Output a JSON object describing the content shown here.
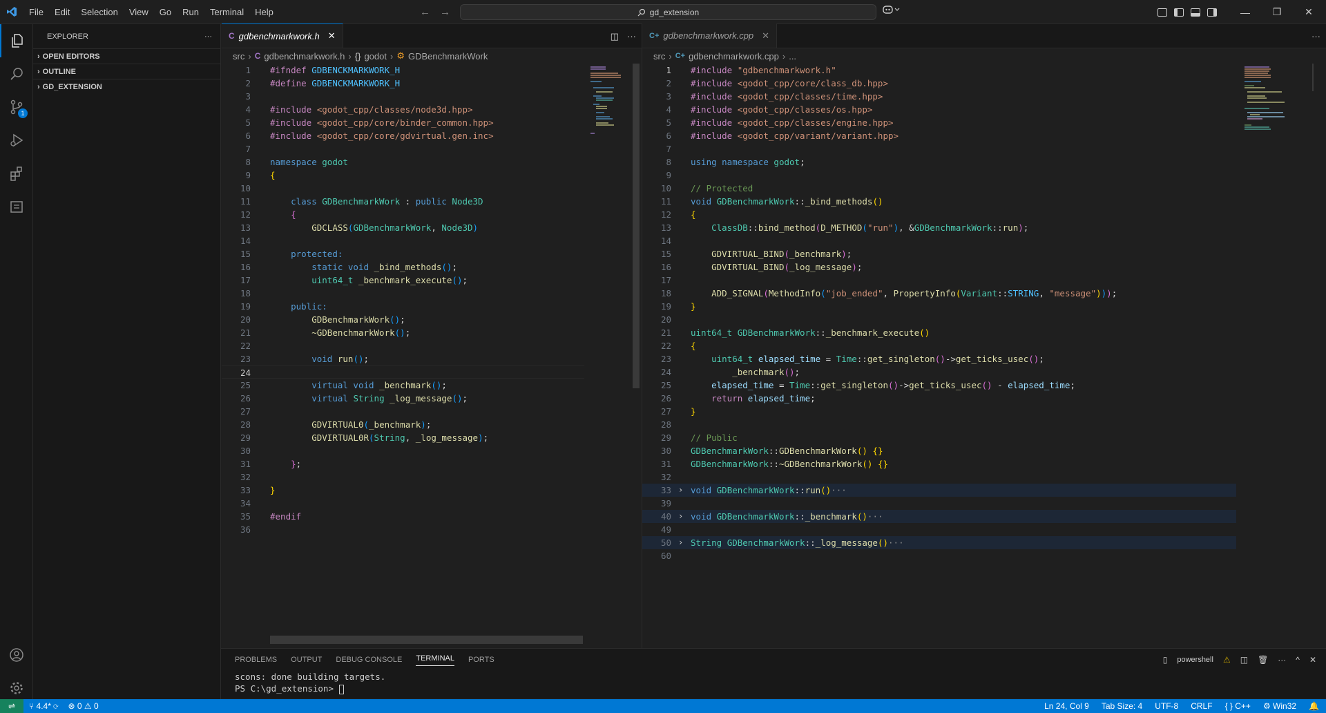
{
  "menu": [
    "File",
    "Edit",
    "Selection",
    "View",
    "Go",
    "Run",
    "Terminal",
    "Help"
  ],
  "search": {
    "text": "gd_extension"
  },
  "window": {
    "minimize": "—",
    "restore": "❐",
    "close": "✕"
  },
  "activity": {
    "scm_badge": "1"
  },
  "sidebar": {
    "title": "EXPLORER",
    "more": "···",
    "sections": [
      "OPEN EDITORS",
      "OUTLINE",
      "GD_EXTENSION"
    ]
  },
  "left_editor": {
    "tab_label": "gdbenchmarkwork.h",
    "breadcrumbs": {
      "folder": "src",
      "file": "gdbenchmarkwork.h",
      "ns": "godot",
      "cls": "GDBenchmarkWork"
    },
    "current_line": 24,
    "lines": [
      [
        [
          "pp",
          "#ifndef "
        ],
        [
          "df",
          "GDBENCKMARKWORK_H"
        ]
      ],
      [
        [
          "pp",
          "#define "
        ],
        [
          "df",
          "GDBENCKMARKWORK_H"
        ]
      ],
      [],
      [
        [
          "pp",
          "#include "
        ],
        [
          "str",
          "<godot_cpp/classes/node3d.hpp>"
        ]
      ],
      [
        [
          "pp",
          "#include "
        ],
        [
          "str",
          "<godot_cpp/core/binder_common.hpp>"
        ]
      ],
      [
        [
          "pp",
          "#include "
        ],
        [
          "str",
          "<godot_cpp/core/gdvirtual.gen.inc>"
        ]
      ],
      [],
      [
        [
          "kw",
          "namespace "
        ],
        [
          "ty",
          "godot"
        ]
      ],
      [
        [
          "br1",
          "{"
        ]
      ],
      [],
      [
        [
          "plain",
          "    "
        ],
        [
          "kw",
          "class "
        ],
        [
          "ty",
          "GDBenchmarkWork"
        ],
        [
          "plain",
          " : "
        ],
        [
          "kw",
          "public "
        ],
        [
          "ty",
          "Node3D"
        ]
      ],
      [
        [
          "plain",
          "    "
        ],
        [
          "br2",
          "{"
        ]
      ],
      [
        [
          "plain",
          "        "
        ],
        [
          "fn",
          "GDCLASS"
        ],
        [
          "br3",
          "("
        ],
        [
          "ty",
          "GDBenchmarkWork"
        ],
        [
          "plain",
          ", "
        ],
        [
          "ty",
          "Node3D"
        ],
        [
          "br3",
          ")"
        ]
      ],
      [],
      [
        [
          "plain",
          "    "
        ],
        [
          "kw",
          "protected:"
        ]
      ],
      [
        [
          "plain",
          "        "
        ],
        [
          "kw",
          "static void "
        ],
        [
          "fn",
          "_bind_methods"
        ],
        [
          "br3",
          "()"
        ],
        [
          "plain",
          ";"
        ]
      ],
      [
        [
          "plain",
          "        "
        ],
        [
          "ty",
          "uint64_t "
        ],
        [
          "fn",
          "_benchmark_execute"
        ],
        [
          "br3",
          "()"
        ],
        [
          "plain",
          ";"
        ]
      ],
      [],
      [
        [
          "plain",
          "    "
        ],
        [
          "kw",
          "public:"
        ]
      ],
      [
        [
          "plain",
          "        "
        ],
        [
          "fn",
          "GDBenchmarkWork"
        ],
        [
          "br3",
          "()"
        ],
        [
          "plain",
          ";"
        ]
      ],
      [
        [
          "plain",
          "        "
        ],
        [
          "fn",
          "~GDBenchmarkWork"
        ],
        [
          "br3",
          "()"
        ],
        [
          "plain",
          ";"
        ]
      ],
      [],
      [
        [
          "plain",
          "        "
        ],
        [
          "kw",
          "void "
        ],
        [
          "fn",
          "run"
        ],
        [
          "br3",
          "()"
        ],
        [
          "plain",
          ";"
        ]
      ],
      [],
      [
        [
          "plain",
          "        "
        ],
        [
          "kw",
          "virtual void "
        ],
        [
          "fn",
          "_benchmark"
        ],
        [
          "br3",
          "()"
        ],
        [
          "plain",
          ";"
        ]
      ],
      [
        [
          "plain",
          "        "
        ],
        [
          "kw",
          "virtual "
        ],
        [
          "ty",
          "String "
        ],
        [
          "fn",
          "_log_message"
        ],
        [
          "br3",
          "()"
        ],
        [
          "plain",
          ";"
        ]
      ],
      [],
      [
        [
          "plain",
          "        "
        ],
        [
          "fn",
          "GDVIRTUAL0"
        ],
        [
          "br3",
          "("
        ],
        [
          "fn",
          "_benchmark"
        ],
        [
          "br3",
          ")"
        ],
        [
          "plain",
          ";"
        ]
      ],
      [
        [
          "plain",
          "        "
        ],
        [
          "fn",
          "GDVIRTUAL0R"
        ],
        [
          "br3",
          "("
        ],
        [
          "ty",
          "String"
        ],
        [
          "plain",
          ", "
        ],
        [
          "fn",
          "_log_message"
        ],
        [
          "br3",
          ")"
        ],
        [
          "plain",
          ";"
        ]
      ],
      [],
      [
        [
          "plain",
          "    "
        ],
        [
          "br2",
          "}"
        ],
        [
          "plain",
          ";"
        ]
      ],
      [],
      [
        [
          "br1",
          "}"
        ]
      ],
      [],
      [
        [
          "pp",
          "#endif"
        ]
      ],
      []
    ]
  },
  "right_editor": {
    "tab_label": "gdbenchmarkwork.cpp",
    "breadcrumbs": {
      "folder": "src",
      "file": "gdbenchmarkwork.cpp",
      "more": "..."
    },
    "current_line": 1,
    "lines": [
      {
        "n": "1",
        "s": [
          [
            "pp",
            "#include "
          ],
          [
            "str",
            "\"gdbenchmarkwork.h\""
          ]
        ]
      },
      {
        "n": "2",
        "s": [
          [
            "pp",
            "#include "
          ],
          [
            "str",
            "<godot_cpp/core/class_db.hpp>"
          ]
        ]
      },
      {
        "n": "3",
        "s": [
          [
            "pp",
            "#include "
          ],
          [
            "str",
            "<godot_cpp/classes/time.hpp>"
          ]
        ]
      },
      {
        "n": "4",
        "s": [
          [
            "pp",
            "#include "
          ],
          [
            "str",
            "<godot_cpp/classes/os.hpp>"
          ]
        ]
      },
      {
        "n": "5",
        "s": [
          [
            "pp",
            "#include "
          ],
          [
            "str",
            "<godot_cpp/classes/engine.hpp>"
          ]
        ]
      },
      {
        "n": "6",
        "s": [
          [
            "pp",
            "#include "
          ],
          [
            "str",
            "<godot_cpp/variant/variant.hpp>"
          ]
        ]
      },
      {
        "n": "7",
        "s": []
      },
      {
        "n": "8",
        "s": [
          [
            "kw",
            "using namespace "
          ],
          [
            "ty",
            "godot"
          ],
          [
            "plain",
            ";"
          ]
        ]
      },
      {
        "n": "9",
        "s": []
      },
      {
        "n": "10",
        "s": [
          [
            "cm",
            "// Protected"
          ]
        ]
      },
      {
        "n": "11",
        "s": [
          [
            "kw",
            "void "
          ],
          [
            "ty",
            "GDBenchmarkWork"
          ],
          [
            "plain",
            "::"
          ],
          [
            "fn",
            "_bind_methods"
          ],
          [
            "br1",
            "()"
          ]
        ]
      },
      {
        "n": "12",
        "s": [
          [
            "br1",
            "{"
          ]
        ]
      },
      {
        "n": "13",
        "s": [
          [
            "plain",
            "    "
          ],
          [
            "ty",
            "ClassDB"
          ],
          [
            "plain",
            "::"
          ],
          [
            "fn",
            "bind_method"
          ],
          [
            "br2",
            "("
          ],
          [
            "fn",
            "D_METHOD"
          ],
          [
            "br3",
            "("
          ],
          [
            "str",
            "\"run\""
          ],
          [
            "br3",
            ")"
          ],
          [
            "plain",
            ", &"
          ],
          [
            "ty",
            "GDBenchmarkWork"
          ],
          [
            "plain",
            "::"
          ],
          [
            "fn",
            "run"
          ],
          [
            "br2",
            ")"
          ],
          [
            "plain",
            ";"
          ]
        ]
      },
      {
        "n": "14",
        "s": []
      },
      {
        "n": "15",
        "s": [
          [
            "plain",
            "    "
          ],
          [
            "fn",
            "GDVIRTUAL_BIND"
          ],
          [
            "br2",
            "("
          ],
          [
            "fn",
            "_benchmark"
          ],
          [
            "br2",
            ")"
          ],
          [
            "plain",
            ";"
          ]
        ]
      },
      {
        "n": "16",
        "s": [
          [
            "plain",
            "    "
          ],
          [
            "fn",
            "GDVIRTUAL_BIND"
          ],
          [
            "br2",
            "("
          ],
          [
            "fn",
            "_log_message"
          ],
          [
            "br2",
            ")"
          ],
          [
            "plain",
            ";"
          ]
        ]
      },
      {
        "n": "17",
        "s": []
      },
      {
        "n": "18",
        "s": [
          [
            "plain",
            "    "
          ],
          [
            "fn",
            "ADD_SIGNAL"
          ],
          [
            "br2",
            "("
          ],
          [
            "fn",
            "MethodInfo"
          ],
          [
            "br3",
            "("
          ],
          [
            "str",
            "\"job_ended\""
          ],
          [
            "plain",
            ", "
          ],
          [
            "fn",
            "PropertyInfo"
          ],
          [
            "br1",
            "("
          ],
          [
            "ty",
            "Variant"
          ],
          [
            "plain",
            "::"
          ],
          [
            "df",
            "STRING"
          ],
          [
            "plain",
            ", "
          ],
          [
            "str",
            "\"message\""
          ],
          [
            "br1",
            ")"
          ],
          [
            "br3",
            ")"
          ],
          [
            "br2",
            ")"
          ],
          [
            "plain",
            ";"
          ]
        ]
      },
      {
        "n": "19",
        "s": [
          [
            "br1",
            "}"
          ]
        ]
      },
      {
        "n": "20",
        "s": []
      },
      {
        "n": "21",
        "s": [
          [
            "ty",
            "uint64_t "
          ],
          [
            "ty",
            "GDBenchmarkWork"
          ],
          [
            "plain",
            "::"
          ],
          [
            "fn",
            "_benchmark_execute"
          ],
          [
            "br1",
            "()"
          ]
        ]
      },
      {
        "n": "22",
        "s": [
          [
            "br1",
            "{"
          ]
        ]
      },
      {
        "n": "23",
        "s": [
          [
            "plain",
            "    "
          ],
          [
            "ty",
            "uint64_t "
          ],
          [
            "vr",
            "elapsed_time"
          ],
          [
            "plain",
            " = "
          ],
          [
            "ty",
            "Time"
          ],
          [
            "plain",
            "::"
          ],
          [
            "fn",
            "get_singleton"
          ],
          [
            "br2",
            "()"
          ],
          [
            "plain",
            "->"
          ],
          [
            "fn",
            "get_ticks_usec"
          ],
          [
            "br2",
            "()"
          ],
          [
            "plain",
            ";"
          ]
        ]
      },
      {
        "n": "24",
        "s": [
          [
            "plain",
            "        "
          ],
          [
            "fn",
            "_benchmark"
          ],
          [
            "br2",
            "()"
          ],
          [
            "plain",
            ";"
          ]
        ]
      },
      {
        "n": "25",
        "s": [
          [
            "plain",
            "    "
          ],
          [
            "vr",
            "elapsed_time"
          ],
          [
            "plain",
            " = "
          ],
          [
            "ty",
            "Time"
          ],
          [
            "plain",
            "::"
          ],
          [
            "fn",
            "get_singleton"
          ],
          [
            "br2",
            "()"
          ],
          [
            "plain",
            "->"
          ],
          [
            "fn",
            "get_ticks_usec"
          ],
          [
            "br2",
            "()"
          ],
          [
            "plain",
            " - "
          ],
          [
            "vr",
            "elapsed_time"
          ],
          [
            "plain",
            ";"
          ]
        ]
      },
      {
        "n": "26",
        "s": [
          [
            "plain",
            "    "
          ],
          [
            "kc",
            "return "
          ],
          [
            "vr",
            "elapsed_time"
          ],
          [
            "plain",
            ";"
          ]
        ]
      },
      {
        "n": "27",
        "s": [
          [
            "br1",
            "}"
          ]
        ]
      },
      {
        "n": "28",
        "s": []
      },
      {
        "n": "29",
        "s": [
          [
            "cm",
            "// Public"
          ]
        ]
      },
      {
        "n": "30",
        "s": [
          [
            "ty",
            "GDBenchmarkWork"
          ],
          [
            "plain",
            "::"
          ],
          [
            "fn",
            "GDBenchmarkWork"
          ],
          [
            "br1",
            "()"
          ],
          [
            "plain",
            " "
          ],
          [
            "br1",
            "{}"
          ]
        ]
      },
      {
        "n": "31",
        "s": [
          [
            "ty",
            "GDBenchmarkWork"
          ],
          [
            "plain",
            "::"
          ],
          [
            "fn",
            "~GDBenchmarkWork"
          ],
          [
            "br1",
            "()"
          ],
          [
            "plain",
            " "
          ],
          [
            "br1",
            "{}"
          ]
        ]
      },
      {
        "n": "32",
        "s": []
      },
      {
        "n": "33",
        "fold": true,
        "s": [
          [
            "kw",
            "void "
          ],
          [
            "ty",
            "GDBenchmarkWork"
          ],
          [
            "plain",
            "::"
          ],
          [
            "fn",
            "run"
          ],
          [
            "br1",
            "()"
          ],
          [
            "ell",
            "···"
          ]
        ]
      },
      {
        "n": "39",
        "s": []
      },
      {
        "n": "40",
        "fold": true,
        "s": [
          [
            "kw",
            "void "
          ],
          [
            "ty",
            "GDBenchmarkWork"
          ],
          [
            "plain",
            "::"
          ],
          [
            "fn",
            "_benchmark"
          ],
          [
            "br1",
            "()"
          ],
          [
            "ell",
            "···"
          ]
        ]
      },
      {
        "n": "49",
        "s": []
      },
      {
        "n": "50",
        "fold": true,
        "s": [
          [
            "ty",
            "String "
          ],
          [
            "ty",
            "GDBenchmarkWork"
          ],
          [
            "plain",
            "::"
          ],
          [
            "fn",
            "_log_message"
          ],
          [
            "br1",
            "()"
          ],
          [
            "ell",
            "···"
          ]
        ]
      },
      {
        "n": "60",
        "s": []
      }
    ]
  },
  "panel": {
    "tabs": [
      "PROBLEMS",
      "OUTPUT",
      "DEBUG CONSOLE",
      "TERMINAL",
      "PORTS"
    ],
    "active_tab": "TERMINAL",
    "shell": "powershell",
    "terminal_lines": [
      "scons: done building targets.",
      "PS C:\\gd_extension> "
    ]
  },
  "status": {
    "branch": "4.4*",
    "errors": "0",
    "warnings": "0",
    "position": "Ln 24, Col 9",
    "tab_size": "Tab Size: 4",
    "encoding": "UTF-8",
    "eol": "CRLF",
    "language": "C++",
    "platform": "Win32"
  }
}
